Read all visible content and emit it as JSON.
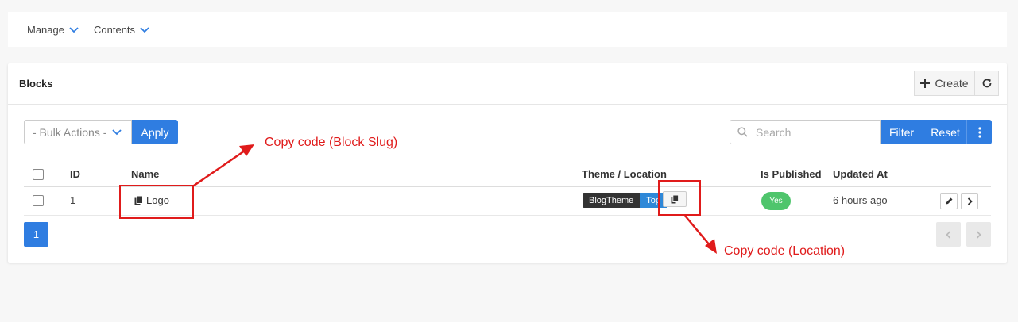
{
  "topnav": {
    "manage": "Manage",
    "contents": "Contents"
  },
  "card": {
    "title": "Blocks"
  },
  "toolbar": {
    "create": "Create",
    "bulk_actions": "- Bulk Actions -",
    "apply": "Apply",
    "search_placeholder": "Search",
    "filter": "Filter",
    "reset": "Reset"
  },
  "table": {
    "columns": {
      "id": "ID",
      "name": "Name",
      "theme_location": "Theme / Location",
      "is_published": "Is Published",
      "updated_at": "Updated At"
    },
    "rows": [
      {
        "id": "1",
        "name": "Logo",
        "theme": "BlogTheme",
        "location": "Top",
        "published": "Yes",
        "updated": "6 hours ago"
      }
    ]
  },
  "pagination": {
    "current": "1"
  },
  "annotations": {
    "block_slug": "Copy code (Block Slug)",
    "location": "Copy code (Location)"
  },
  "colors": {
    "primary": "#2f7de1",
    "success": "#4fc56c",
    "annotation": "#e01b1b",
    "dark_tag": "#333333",
    "location_tag": "#2e88d8"
  },
  "icons": [
    "chevron-down-icon",
    "plus-icon",
    "refresh-icon",
    "search-icon",
    "more-vertical-icon",
    "copy-icon",
    "pencil-icon",
    "chevron-right-icon",
    "chevron-left-icon"
  ]
}
